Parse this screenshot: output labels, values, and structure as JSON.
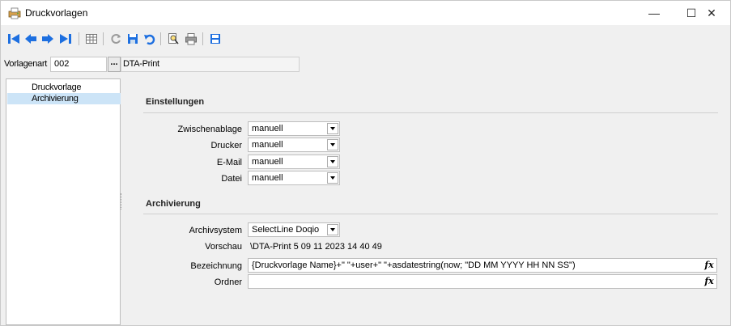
{
  "window": {
    "title": "Druckvorlagen",
    "min_glyph": "—",
    "max_glyph": "☐",
    "close_glyph": "✕"
  },
  "toolbar": {
    "icons": [
      "first-record-icon",
      "previous-record-icon",
      "next-record-icon",
      "last-record-icon",
      "table-view-icon",
      "refresh-icon",
      "save-icon",
      "undo-icon",
      "print-preview-icon",
      "print-icon",
      "save-disk-icon"
    ]
  },
  "vorlage": {
    "label": "Vorlagenart",
    "value": "002",
    "dots": "...",
    "name": "DTA-Print"
  },
  "tree": {
    "items": [
      {
        "label": "Druckvorlage",
        "selected": false
      },
      {
        "label": "Archivierung",
        "selected": true
      }
    ]
  },
  "einstellungen": {
    "title": "Einstellungen",
    "rows": [
      {
        "label": "Zwischenablage",
        "value": "manuell"
      },
      {
        "label": "Drucker",
        "value": "manuell"
      },
      {
        "label": "E-Mail",
        "value": "manuell"
      },
      {
        "label": "Datei",
        "value": "manuell"
      }
    ]
  },
  "archivierung": {
    "title": "Archivierung",
    "archivsystem_label": "Archivsystem",
    "archivsystem_value": "SelectLine Doqio",
    "vorschau_label": "Vorschau",
    "vorschau_value": "\\DTA-Print  5 09 11 2023 14 40 49",
    "bezeichnung_label": "Bezeichnung",
    "bezeichnung_value": "{Druckvorlage Name}+\" \"+user+\" \"+asdatestring(now; \"DD MM YYYY HH NN SS\")",
    "ordner_label": "Ordner",
    "ordner_value": "",
    "fx_glyph": "fx"
  },
  "colors": {
    "selection": "#cce4f7",
    "nav_blue": "#1d6fe0"
  }
}
